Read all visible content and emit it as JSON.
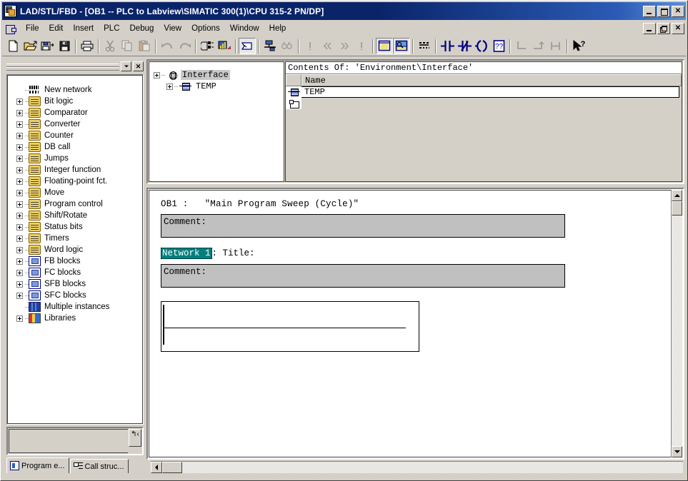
{
  "window": {
    "title": "LAD/STL/FBD  - [OB1 -- PLC to Labview\\SIMATIC 300(1)\\CPU 315-2 PN/DP]",
    "app_icon": "lad-stl-fbd-icon",
    "controls": {
      "minimize": "_",
      "maximize": "□",
      "close": "✕",
      "child_minimize": "_",
      "child_restore": "❐",
      "child_close": "✕"
    }
  },
  "menubar": {
    "system_icon": "system-menu-icon",
    "items": [
      {
        "label": "File"
      },
      {
        "label": "Edit"
      },
      {
        "label": "Insert"
      },
      {
        "label": "PLC"
      },
      {
        "label": "Debug"
      },
      {
        "label": "View"
      },
      {
        "label": "Options"
      },
      {
        "label": "Window"
      },
      {
        "label": "Help"
      }
    ]
  },
  "toolbar": {
    "groups": [
      {
        "buttons": [
          {
            "name": "new-icon",
            "title": "New"
          },
          {
            "name": "open-icon",
            "title": "Open"
          },
          {
            "name": "save-as-icon",
            "title": "Save As"
          },
          {
            "name": "save-icon",
            "title": "Save"
          }
        ]
      },
      {
        "buttons": [
          {
            "name": "print-icon",
            "title": "Print"
          }
        ]
      },
      {
        "buttons": [
          {
            "name": "cut-icon",
            "title": "Cut",
            "disabled": true
          },
          {
            "name": "copy-icon",
            "title": "Copy",
            "disabled": true
          },
          {
            "name": "paste-icon",
            "title": "Paste",
            "disabled": true
          }
        ]
      },
      {
        "buttons": [
          {
            "name": "undo-icon",
            "title": "Undo",
            "disabled": true
          },
          {
            "name": "redo-icon",
            "title": "Redo",
            "disabled": true
          }
        ]
      },
      {
        "buttons": [
          {
            "name": "download-icon",
            "title": "Download"
          },
          {
            "name": "monitor-icon",
            "title": "Monitor"
          }
        ]
      },
      {
        "buttons": [
          {
            "name": "display-with-icon",
            "title": "Display with",
            "pressed": true
          }
        ]
      },
      {
        "buttons": [
          {
            "name": "symbol-table-icon",
            "title": "Symbol Table"
          },
          {
            "name": "symbolic-representation-icon",
            "title": "Symbolic Representation",
            "disabled": true
          }
        ]
      },
      {
        "buttons": [
          {
            "name": "go-to-first-error-icon",
            "title": "Go To First Error",
            "disabled": true
          },
          {
            "name": "go-to-previous-error-icon",
            "title": "Go To Previous Error",
            "disabled": true
          },
          {
            "name": "go-to-next-error-icon",
            "title": "Go To Next Error",
            "disabled": true
          },
          {
            "name": "go-to-last-error-icon",
            "title": "Go To Last Error",
            "disabled": true
          }
        ]
      },
      {
        "buttons": [
          {
            "name": "declaration-view-icon",
            "title": "Declaration View",
            "pressed": true
          },
          {
            "name": "overviews-icon",
            "title": "Overviews",
            "pressed": true
          }
        ]
      },
      {
        "buttons": [
          {
            "name": "new-network-icon",
            "title": "New Network"
          }
        ]
      },
      {
        "buttons": [
          {
            "name": "normally-open-contact-icon",
            "title": "Normally Open Contact"
          },
          {
            "name": "normally-closed-contact-icon",
            "title": "Normally Closed Contact"
          },
          {
            "name": "output-coil-icon",
            "title": "Output Coil"
          },
          {
            "name": "empty-box-icon",
            "title": "Empty Box"
          }
        ]
      },
      {
        "buttons": [
          {
            "name": "branch-open-icon",
            "title": "Open Branch",
            "disabled": true
          },
          {
            "name": "branch-close-icon",
            "title": "Close Branch",
            "disabled": true
          },
          {
            "name": "branch-connector-icon",
            "title": "Branch Connector",
            "disabled": true
          }
        ]
      },
      {
        "buttons": [
          {
            "name": "context-help-icon",
            "title": "Help"
          }
        ]
      }
    ]
  },
  "left_panel": {
    "close_label": "✕",
    "dropdown_label": "▼",
    "tree": [
      {
        "label": "New network",
        "icon": "new-network-icon",
        "expandable": false,
        "indent": 1
      },
      {
        "label": "Bit logic",
        "icon": "bit-logic-folder-icon",
        "expandable": true,
        "indent": 0
      },
      {
        "label": "Comparator",
        "icon": "comparator-folder-icon",
        "expandable": true,
        "indent": 0
      },
      {
        "label": "Converter",
        "icon": "converter-folder-icon",
        "expandable": true,
        "indent": 0
      },
      {
        "label": "Counter",
        "icon": "counter-folder-icon",
        "expandable": true,
        "indent": 0
      },
      {
        "label": "DB call",
        "icon": "db-call-folder-icon",
        "expandable": true,
        "indent": 0
      },
      {
        "label": "Jumps",
        "icon": "jumps-folder-icon",
        "expandable": true,
        "indent": 0
      },
      {
        "label": "Integer function",
        "icon": "integer-function-folder-icon",
        "expandable": true,
        "indent": 0
      },
      {
        "label": "Floating-point fct.",
        "icon": "floating-point-folder-icon",
        "expandable": true,
        "indent": 0
      },
      {
        "label": "Move",
        "icon": "move-folder-icon",
        "expandable": true,
        "indent": 0
      },
      {
        "label": "Program control",
        "icon": "program-control-folder-icon",
        "expandable": true,
        "indent": 0
      },
      {
        "label": "Shift/Rotate",
        "icon": "shift-rotate-folder-icon",
        "expandable": true,
        "indent": 0
      },
      {
        "label": "Status bits",
        "icon": "status-bits-folder-icon",
        "expandable": true,
        "indent": 0
      },
      {
        "label": "Timers",
        "icon": "timers-folder-icon",
        "expandable": true,
        "indent": 0
      },
      {
        "label": "Word logic",
        "icon": "word-logic-folder-icon",
        "expandable": true,
        "indent": 0
      },
      {
        "label": "FB blocks",
        "icon": "fb-blocks-icon",
        "expandable": true,
        "indent": 0
      },
      {
        "label": "FC blocks",
        "icon": "fc-blocks-icon",
        "expandable": true,
        "indent": 0
      },
      {
        "label": "SFB blocks",
        "icon": "sfb-blocks-icon",
        "expandable": true,
        "indent": 0
      },
      {
        "label": "SFC blocks",
        "icon": "sfc-blocks-icon",
        "expandable": true,
        "indent": 0
      },
      {
        "label": "Multiple instances",
        "icon": "multiple-instances-icon",
        "expandable": false,
        "indent": 1
      },
      {
        "label": "Libraries",
        "icon": "libraries-icon",
        "expandable": true,
        "indent": 0
      }
    ],
    "tabs": [
      {
        "label": "Program e...",
        "icon": "program-elements-icon",
        "active": true
      },
      {
        "label": "Call struc...",
        "icon": "call-structure-icon",
        "active": false
      }
    ],
    "updown_button": "up-level-button"
  },
  "declaration": {
    "tree": [
      {
        "label": "Interface",
        "icon": "interface-icon",
        "level": 1,
        "expanded": true,
        "selected": true
      },
      {
        "label": "TEMP",
        "icon": "temp-variable-icon",
        "level": 2,
        "expanded": false,
        "selected": false
      }
    ],
    "contents_title": "Contents Of:  'Environment\\Interface'",
    "columns": [
      "",
      "Name"
    ],
    "rows": [
      {
        "icon": "temp-variable-icon",
        "name": "TEMP",
        "selected": true
      },
      {
        "icon": "new-declaration-row-icon",
        "name": "",
        "selected": false
      }
    ]
  },
  "editor": {
    "block_title": "OB1 :   \"Main Program Sweep (Cycle)\"",
    "block_comment": "Comment:",
    "network_label": "Network 1",
    "network_title_suffix": ": Title:",
    "network_comment": "Comment:",
    "rung": {
      "name": "empty-ladder-rung",
      "elements": []
    }
  },
  "colors": {
    "titlebar": "#0a246a",
    "face": "#d4d0c8",
    "comment_box": "#c0c0c0",
    "network_selection": "#008080",
    "editor_background": "#ffffff"
  },
  "scrollbars": {
    "vertical_up": "▲",
    "vertical_down": "▼",
    "horizontal_left": "◀",
    "horizontal_right": "▶"
  }
}
